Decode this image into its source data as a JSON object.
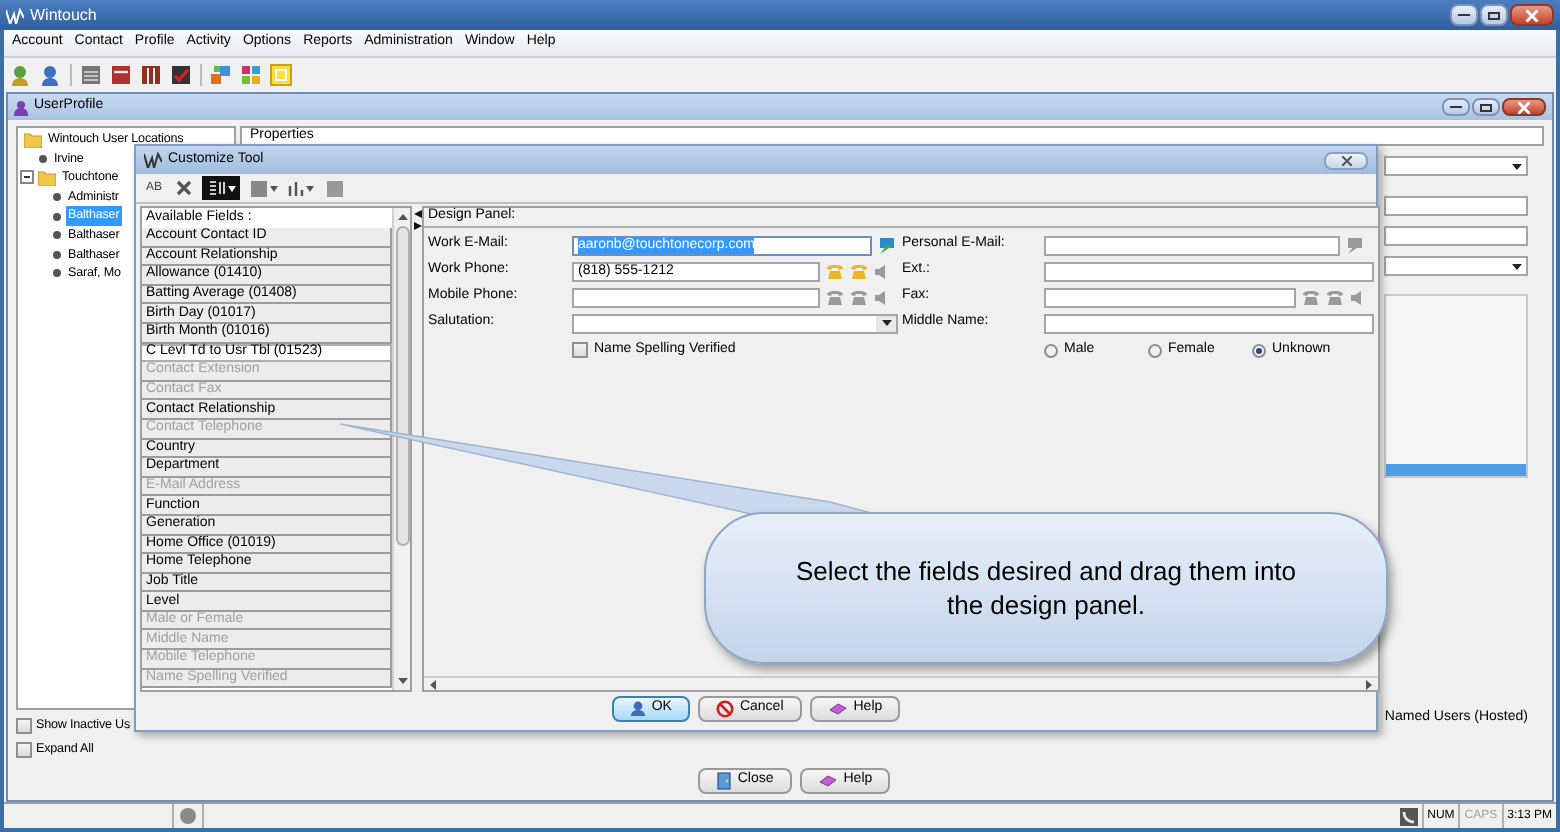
{
  "app": {
    "title": "Wintouch"
  },
  "menu": [
    "Account",
    "Contact",
    "Profile",
    "Activity",
    "Options",
    "Reports",
    "Administration",
    "Window",
    "Help"
  ],
  "user_profile": {
    "title": "UserProfile",
    "properties_header": "Properties",
    "tree": [
      {
        "label": "Wintouch User Locations",
        "selected": false,
        "children": [
          {
            "label": "Irvine",
            "selected": false
          },
          {
            "label": "Touchtone",
            "selected": false,
            "expanded": true,
            "children": [
              {
                "label": "Administr",
                "selected": false
              },
              {
                "label": "Balthaser",
                "selected": true
              },
              {
                "label": "Balthaser",
                "selected": false
              },
              {
                "label": "Balthaser",
                "selected": false
              },
              {
                "label": "Saraf, Mo",
                "selected": false
              }
            ]
          }
        ]
      }
    ],
    "checkboxes": [
      {
        "label": "Show Inactive Us",
        "checked": false
      },
      {
        "label": "Expand All",
        "checked": false
      }
    ],
    "named_users_label": "Named Users (Hosted)",
    "buttons": [
      {
        "label": "Close",
        "kind": "close"
      },
      {
        "label": "Help",
        "kind": "help"
      }
    ]
  },
  "dialog": {
    "title": "Customize Tool",
    "toolbar": [
      {
        "kind": "text",
        "label": "AB",
        "selected": false
      },
      {
        "kind": "delete",
        "selected": false
      },
      {
        "kind": "layout",
        "selected": true
      },
      {
        "kind": "fill",
        "selected": false
      },
      {
        "kind": "chart",
        "selected": false
      },
      {
        "kind": "box",
        "selected": false
      }
    ],
    "fields_header": "Available Fields :",
    "fields": [
      {
        "label": "Account Contact ID",
        "disabled": false,
        "selected": false
      },
      {
        "label": "Account Relationship",
        "disabled": false,
        "selected": false
      },
      {
        "label": "Allowance (01410)",
        "disabled": false,
        "selected": false
      },
      {
        "label": "Batting Average (01408)",
        "disabled": false,
        "selected": false
      },
      {
        "label": "Birth Day (01017)",
        "disabled": false,
        "selected": false
      },
      {
        "label": "Birth Month (01016)",
        "disabled": false,
        "selected": false
      },
      {
        "label": "C Levl Td to Usr Tbl (01523)",
        "disabled": false,
        "selected": true
      },
      {
        "label": "Contact Extension",
        "disabled": true,
        "selected": false
      },
      {
        "label": "Contact Fax",
        "disabled": true,
        "selected": false
      },
      {
        "label": "Contact Relationship",
        "disabled": false,
        "selected": false
      },
      {
        "label": "Contact Telephone",
        "disabled": true,
        "selected": false
      },
      {
        "label": "Country",
        "disabled": false,
        "selected": false
      },
      {
        "label": "Department",
        "disabled": false,
        "selected": false
      },
      {
        "label": "E-Mail Address",
        "disabled": true,
        "selected": false
      },
      {
        "label": "Function",
        "disabled": false,
        "selected": false
      },
      {
        "label": "Generation",
        "disabled": false,
        "selected": false
      },
      {
        "label": "Home Office (01019)",
        "disabled": false,
        "selected": false
      },
      {
        "label": "Home Telephone",
        "disabled": false,
        "selected": false
      },
      {
        "label": "Job Title",
        "disabled": false,
        "selected": false
      },
      {
        "label": "Level",
        "disabled": false,
        "selected": false
      },
      {
        "label": "Male or Female",
        "disabled": true,
        "selected": false
      },
      {
        "label": "Middle Name",
        "disabled": true,
        "selected": false
      },
      {
        "label": "Mobile Telephone",
        "disabled": true,
        "selected": false
      },
      {
        "label": "Name Spelling Verified",
        "disabled": true,
        "selected": false
      }
    ],
    "design_panel": {
      "title": "Design Panel:",
      "rows": [
        {
          "left": {
            "label": "Work E-Mail:",
            "kind": "email",
            "value": "aaronb@touchtonecorp.com",
            "highlighted": true
          },
          "right": {
            "label": "Personal E-Mail:",
            "kind": "email"
          }
        },
        {
          "left": {
            "label": "Work Phone:",
            "kind": "phone",
            "value": "(818) 555-1212",
            "highlighted": false
          },
          "right": {
            "label": "Ext.:",
            "kind": "text"
          }
        },
        {
          "left": {
            "label": "Mobile Phone:",
            "kind": "phone"
          },
          "right": {
            "label": "Fax:",
            "kind": "phone"
          }
        },
        {
          "left": {
            "label": "Salutation:",
            "kind": "select"
          },
          "right": {
            "label": "Middle Name:",
            "kind": "text"
          }
        }
      ],
      "checkbox": {
        "label": "Name Spelling Verified",
        "checked": false
      },
      "radios": [
        {
          "label": "Male",
          "selected": false
        },
        {
          "label": "Female",
          "selected": false
        },
        {
          "label": "Unknown",
          "selected": true
        }
      ]
    },
    "buttons": [
      {
        "label": "OK",
        "kind": "ok",
        "default": true
      },
      {
        "label": "Cancel",
        "kind": "cancel",
        "default": false
      },
      {
        "label": "Help",
        "kind": "help",
        "default": false
      }
    ]
  },
  "callout": "Select the fields desired and drag them into the design panel.",
  "status_bar": {
    "indicators": [
      {
        "label": "NUM",
        "active": true
      },
      {
        "label": "CAPS",
        "active": false
      }
    ],
    "time": "3:13 PM"
  }
}
